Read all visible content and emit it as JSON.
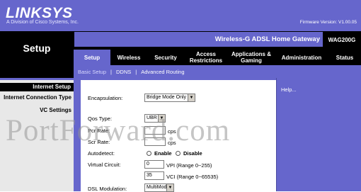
{
  "brand": {
    "logo_text": "LINKSYS",
    "tagline": "A Division of Cisco Systems, Inc.",
    "firmware": "Firmware Version: V1.00.05"
  },
  "section_title": "Setup",
  "product": {
    "name": "Wireless-G ADSL Home Gateway",
    "model": "WAG200G"
  },
  "tabs": [
    {
      "label": "Setup",
      "active": true
    },
    {
      "label": "Wireless"
    },
    {
      "label": "Security"
    },
    {
      "label": "Access Restrictions"
    },
    {
      "label": "Applications & Gaming"
    },
    {
      "label": "Administration"
    },
    {
      "label": "Status"
    }
  ],
  "subnav": [
    {
      "label": "Basic Setup",
      "active": true
    },
    {
      "label": "DDNS"
    },
    {
      "label": "Advanced Routing"
    }
  ],
  "sidebar": {
    "title": "Internet Setup",
    "items": [
      "Internet Connection Type",
      "VC Settings"
    ]
  },
  "form": {
    "encapsulation": {
      "label": "Encapsulation:",
      "value": "Bridge Mode Only"
    },
    "qos_type": {
      "label": "Qos Type:",
      "value": "UBR"
    },
    "pcr_rate": {
      "label": "Pcr Rate:",
      "value": "",
      "unit": "cps"
    },
    "scr_rate": {
      "label": "Scr Rate:",
      "value": "",
      "unit": "cps"
    },
    "autodetect": {
      "label": "Autodetect:",
      "enable": "Enable",
      "disable": "Disable"
    },
    "virtual_circuit": {
      "label": "Virtual Circuit:",
      "vpi": "0",
      "vpi_hint": "VPI (Range 0~255)",
      "vci": "35",
      "vci_hint": "VCI (Range 0~65535)"
    },
    "dsl_modulation": {
      "label": "DSL Modulation:",
      "value": "MultiMode"
    }
  },
  "help_label": "Help...",
  "watermark": "PortForward.com"
}
